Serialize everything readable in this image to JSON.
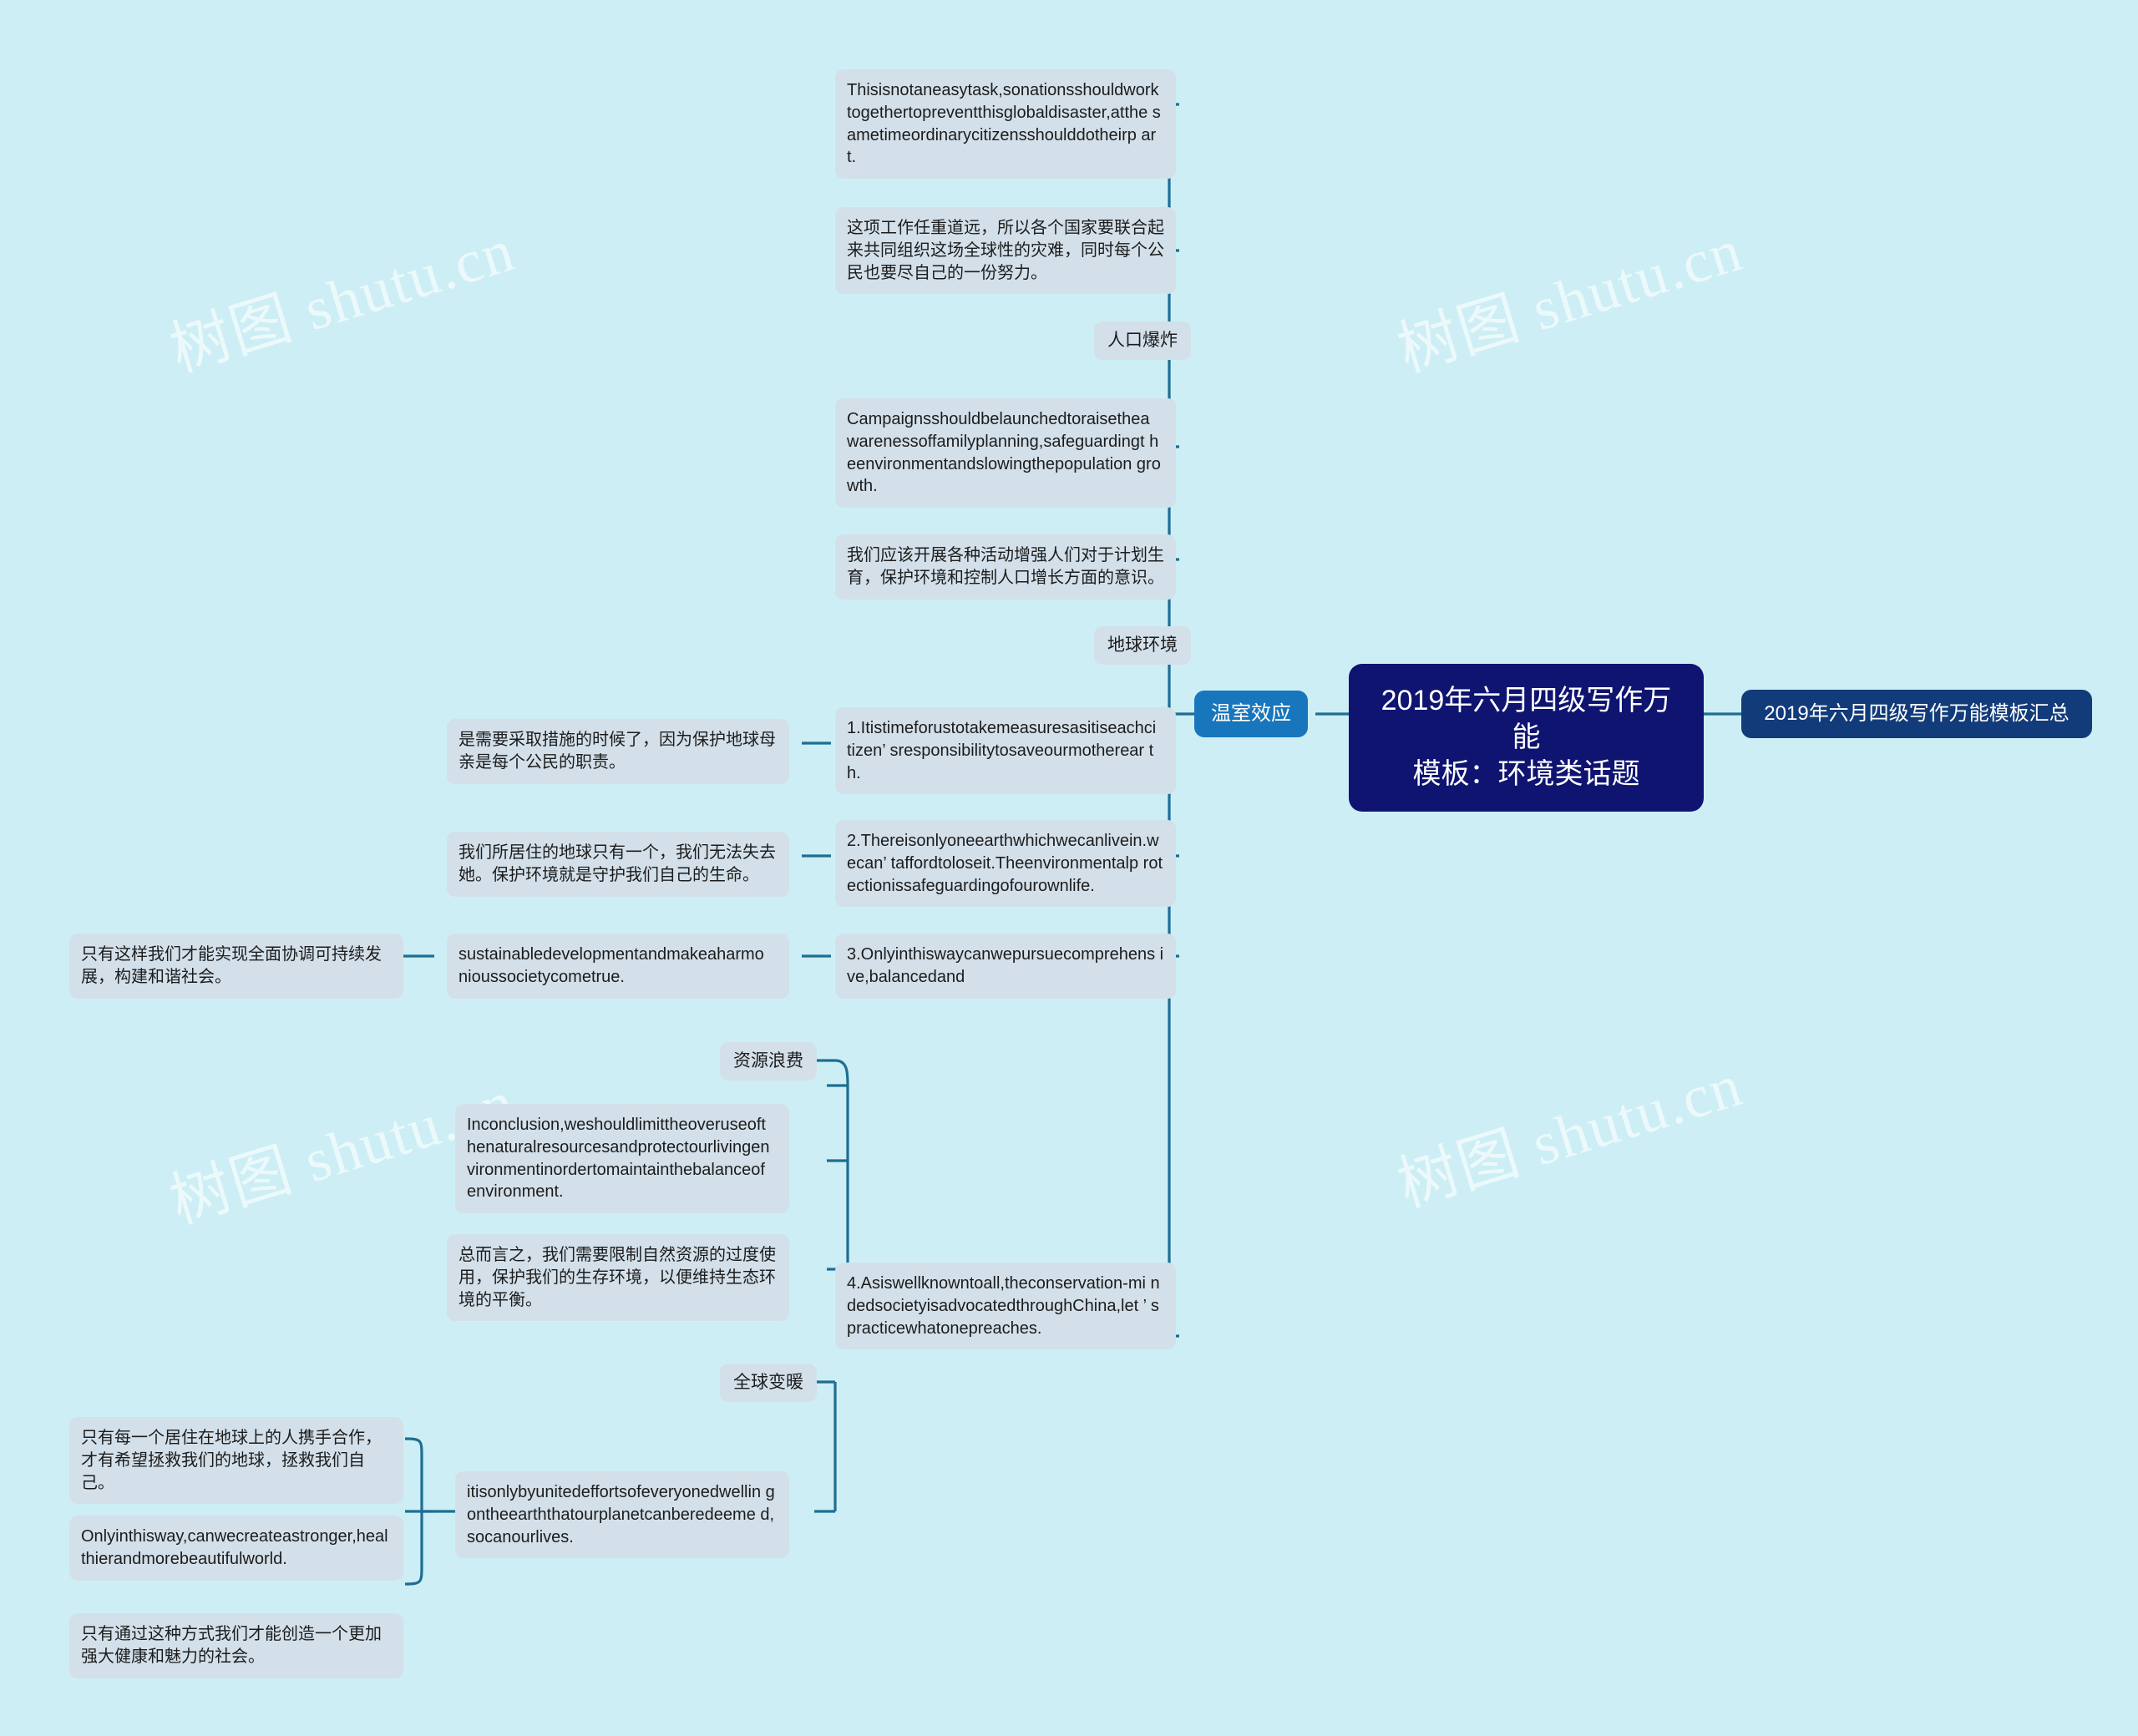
{
  "page": {
    "background_color": "#cdeef5",
    "watermark_text": "树图 shutu.cn"
  },
  "colors": {
    "root_bg": "#0f1470",
    "accent_chip_bg": "#1876bc",
    "dark_chip_bg": "#123b7a",
    "leaf_bg": "#d3e0ea",
    "link_line": "#1d6e92"
  },
  "root": {
    "label": "2019年六月四级写作万能\n模板：环境类话题"
  },
  "related": {
    "label": "2019年六月四级写作万能模板汇总"
  },
  "branches": [
    {
      "id": "greenhouse",
      "label": "温室效应",
      "children": [
        {
          "id": "population-explosion",
          "label": "人口爆炸",
          "children": [
            {
              "id": "pe-en-1",
              "label": "Thisisnotaneasytask,sonationsshouldwork togethertopreventthisglobaldisaster,atthe sametimeordinarycitizensshoulddotheirp art."
            },
            {
              "id": "pe-cn-1",
              "label": "这项工作任重道远，所以各个国家要联合起来共同组织这场全球性的灾难，同时每个公民也要尽自己的一份努力。"
            }
          ]
        },
        {
          "id": "earth-environment",
          "label": "地球环境",
          "children": [
            {
              "id": "ee-en-1",
              "label": "Campaignsshouldbelaunchedtoraisethea warenessoffamilyplanning,safeguardingt heenvironmentandslowingthepopulation growth."
            },
            {
              "id": "ee-cn-1",
              "label": "我们应该开展各种活动增强人们对于计划生育，保护环境和控制人口增长方面的意识。"
            }
          ]
        }
      ]
    }
  ],
  "nodes": [
    {
      "id": "point-1",
      "label": "1.Itistimeforustotakemeasuresasitiseachci tizen’ sresponsibilitytosaveourmotherear th.",
      "child": {
        "id": "point-1-cn",
        "label": "是需要采取措施的时候了，因为保护地球母亲是每个公民的职责。"
      }
    },
    {
      "id": "point-2",
      "label": "2.Thereisonlyoneearthwhichwecanlivein.w ecan’ taffordtoloseit.Theenvironmentalp rotectionissafeguardingofourownlife.",
      "child": {
        "id": "point-2-cn",
        "label": "我们所居住的地球只有一个，我们无法失去她。保护环境就是守护我们自己的生命。"
      }
    },
    {
      "id": "point-3",
      "label": "3.Onlyinthiswaycanwepursuecomprehens ive,balancedand",
      "child": {
        "id": "point-3-en2",
        "label": "sustainabledevelopmentandmakeaharmo nioussocietycometrue."
      },
      "grandchild": {
        "id": "point-3-cn",
        "label": "只有这样我们才能实现全面协调可持续发展，构建和谐社会。"
      }
    },
    {
      "id": "point-4",
      "label": "4.Asiswellknowntoall,theconservation-mi ndedsocietyisadvocatedthroughChina,let ’ spracticewhatonepreaches."
    }
  ],
  "topics": {
    "resource_waste": "资源浪费",
    "global_warming": "全球变暖"
  },
  "resource_waste_children": [
    {
      "id": "rw-en",
      "label": "Inconclusion,weshouldlimittheoveruseoft henaturalresourcesandprotectourlivingen vironmentinordertomaintainthebalanceof environment."
    },
    {
      "id": "rw-cn",
      "label": "总而言之，我们需要限制自然资源的过度使用，保护我们的生存环境，以便维持生态环境的平衡。"
    }
  ],
  "global_warming_children": [
    {
      "id": "gw-en",
      "label": "itisonlybyunitedeffortsofeveryonedwellin gontheearththatourplanetcanberedeeme d,socanourlives."
    }
  ],
  "global_warming_grandchildren": [
    {
      "id": "gw-cn-1",
      "label": "只有每一个居住在地球上的人携手合作，才有希望拯救我们的地球，拯救我们自己。"
    },
    {
      "id": "gw-en-2",
      "label": "Onlyinthisway,canwecreateastronger,heal thierandmorebeautifulworld."
    },
    {
      "id": "gw-cn-2",
      "label": "只有通过这种方式我们才能创造一个更加强大健康和魅力的社会。"
    }
  ]
}
